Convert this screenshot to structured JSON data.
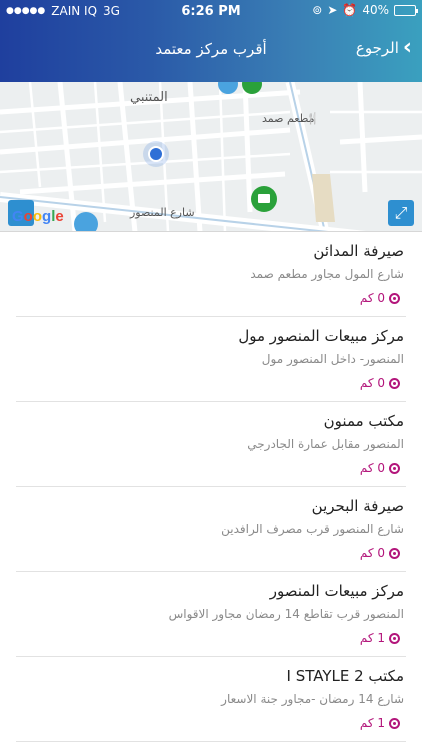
{
  "status_bar": {
    "carrier": "ZAIN IQ",
    "network": "3G",
    "time": "6:26 PM",
    "battery": "40%",
    "battery_level": 0.4
  },
  "header": {
    "title": "أقرب مركز معتمد",
    "back_label": "الرجوع"
  },
  "map": {
    "labels": {
      "district": "المتنبي",
      "restaurant": "مطعم صمد",
      "street": "شارع المنصور"
    },
    "google_logo": "Google"
  },
  "centers": [
    {
      "name": "صيرفة المدائن",
      "address": "شارع المول مجاور مطعم صمد",
      "distance": "0 كم"
    },
    {
      "name": "مركز مبيعات المنصور مول",
      "address": "المنصور- داخل المنصور مول",
      "distance": "0 كم"
    },
    {
      "name": "مكتب ممنون",
      "address": "المنصور مقابل عمارة الجادرجي",
      "distance": "0 كم"
    },
    {
      "name": "صيرفة البحرين",
      "address": "شارع المنصور قرب مصرف الرافدين",
      "distance": "0 كم"
    },
    {
      "name": "مركز مبيعات المنصور",
      "address": "المنصور قرب تقاطع 14 رمضان مجاور الاقواس",
      "distance": "1 كم"
    },
    {
      "name": "مكتب I STAYLE 2",
      "address": "شارع 14 رمضان -مجاور جنة الاسعار",
      "distance": "1 كم"
    }
  ],
  "colors": {
    "header_start": "#1f3f9e",
    "header_end": "#3aa0bf",
    "distance": "#b3157b",
    "map_pin_green": "#2aa13a",
    "map_user_dot": "#2f6fd6"
  }
}
